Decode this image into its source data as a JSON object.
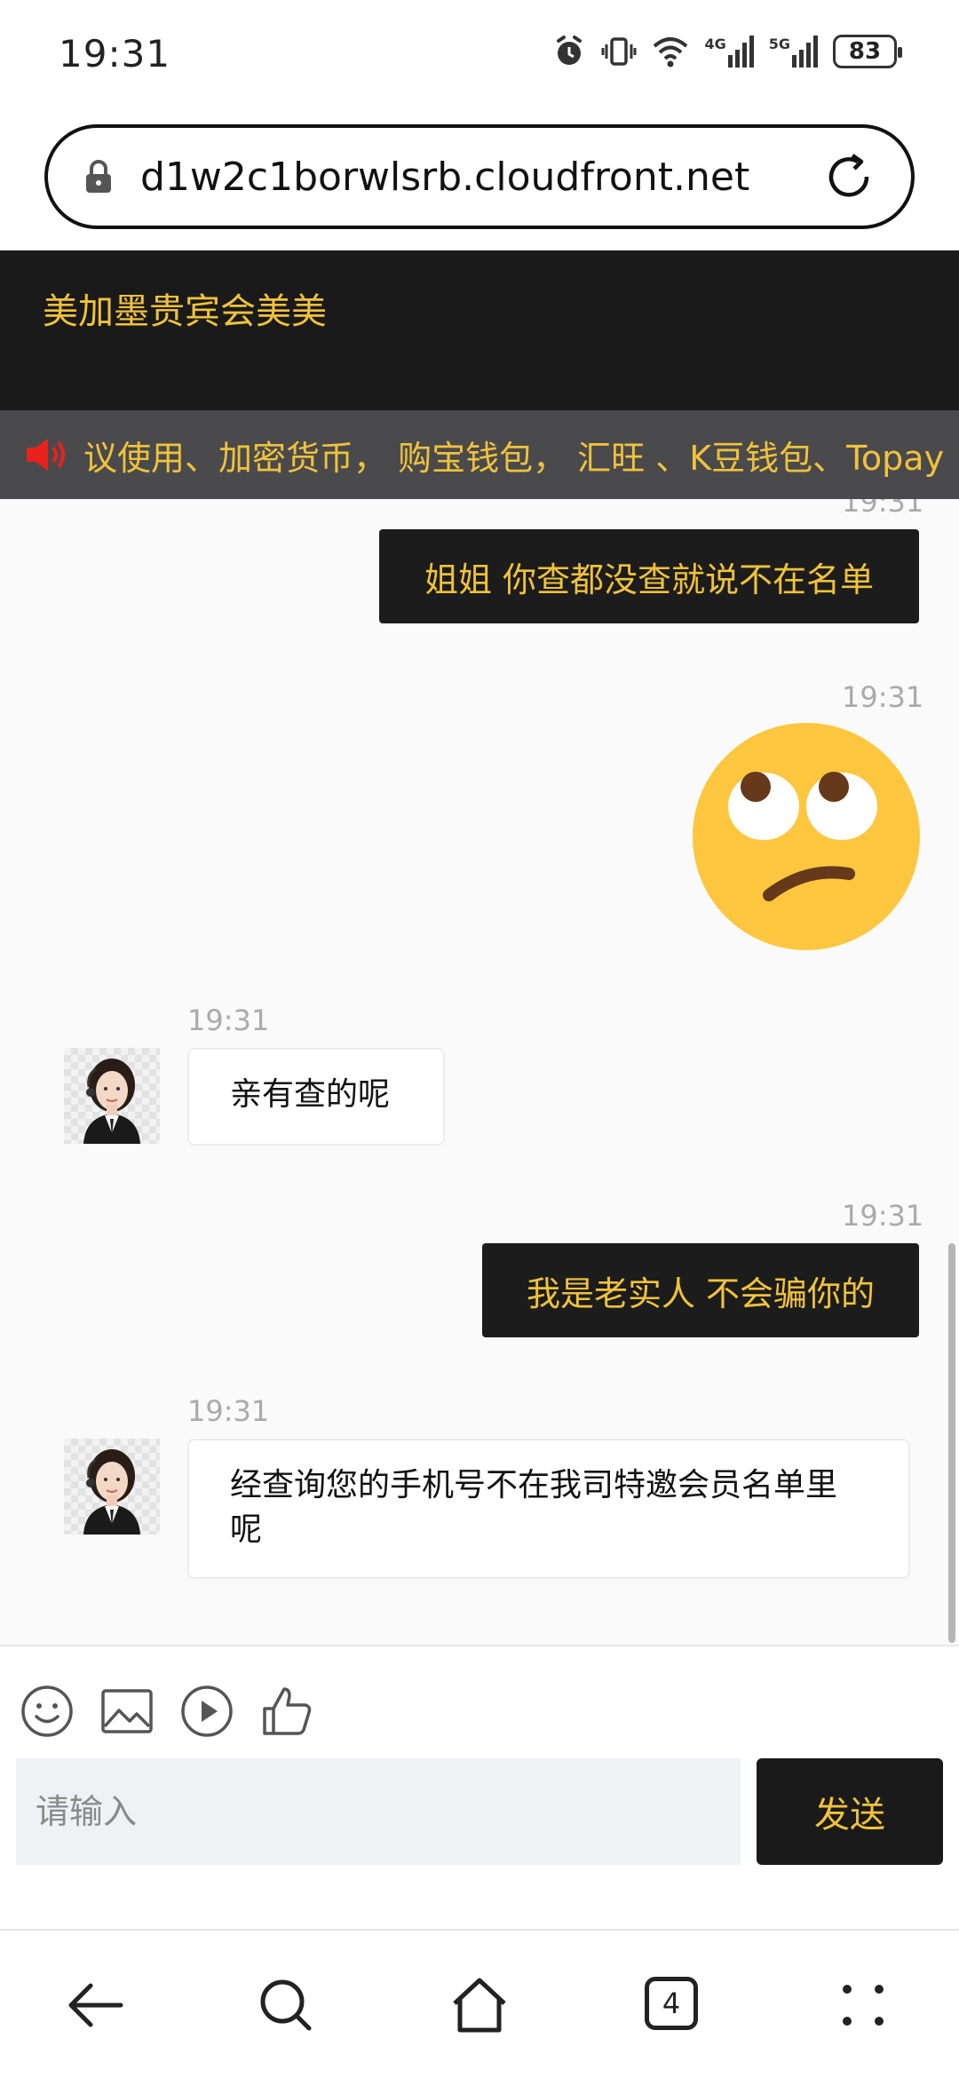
{
  "status_bar": {
    "time": "19:31",
    "network_1": "4G",
    "network_2": "5G",
    "battery": "83"
  },
  "browser": {
    "url": "d1w2c1borwlsrb.cloudfront.net",
    "tabs_count": "4"
  },
  "header": {
    "title": "美加墨贵宾会美美"
  },
  "marquee": {
    "text": "议使用、加密货币， 购宝钱包， 汇旺 、K豆钱包、Topay"
  },
  "messages": [
    {
      "side": "out",
      "time": "19:31",
      "text": "姐姐 你查都没查就说不在名单"
    },
    {
      "side": "out",
      "time": "19:31",
      "type": "emoji",
      "emoji": "face-with-rolling-eyes"
    },
    {
      "side": "in",
      "time": "19:31",
      "text": "亲有查的呢"
    },
    {
      "side": "out",
      "time": "19:31",
      "text": "我是老实人 不会骗你的"
    },
    {
      "side": "in",
      "time": "19:31",
      "text": "经查询您的手机号不在我司特邀会员名单里呢"
    }
  ],
  "composer": {
    "placeholder": "请输入",
    "send_label": "发送"
  },
  "colors": {
    "accent": "#f0c23c",
    "dark": "#1a1a1a",
    "marquee_bg": "#4a4a4c"
  }
}
